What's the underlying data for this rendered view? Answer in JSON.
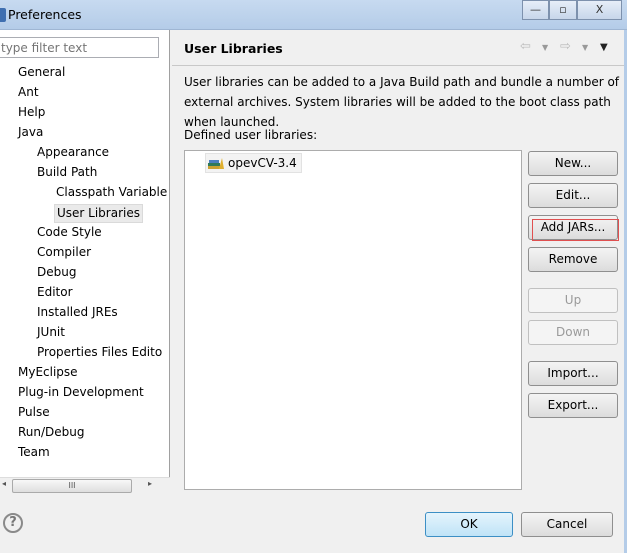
{
  "window": {
    "title": "Preferences",
    "minimize": "—",
    "maximize": "▫",
    "close": "X"
  },
  "sidebar": {
    "filter_placeholder": "type filter text",
    "items": [
      {
        "label": "General",
        "level": 0
      },
      {
        "label": "Ant",
        "level": 0
      },
      {
        "label": "Help",
        "level": 0
      },
      {
        "label": "Java",
        "level": 0
      },
      {
        "label": "Appearance",
        "level": 1
      },
      {
        "label": "Build Path",
        "level": 1
      },
      {
        "label": "Classpath Variable",
        "level": 2
      },
      {
        "label": "User Libraries",
        "level": 2,
        "selected": true
      },
      {
        "label": "Code Style",
        "level": 1
      },
      {
        "label": "Compiler",
        "level": 1
      },
      {
        "label": "Debug",
        "level": 1
      },
      {
        "label": "Editor",
        "level": 1
      },
      {
        "label": "Installed JREs",
        "level": 1
      },
      {
        "label": "JUnit",
        "level": 1
      },
      {
        "label": "Properties Files Edito",
        "level": 1
      },
      {
        "label": "MyEclipse",
        "level": 0
      },
      {
        "label": "Plug-in Development",
        "level": 0
      },
      {
        "label": "Pulse",
        "level": 0
      },
      {
        "label": "Run/Debug",
        "level": 0
      },
      {
        "label": "Team",
        "level": 0
      }
    ],
    "scroll_thumb": "III"
  },
  "page": {
    "title": "User Libraries",
    "description": "User libraries can be added to a Java Build path and bundle a number of external archives. System libraries will be added to the boot class path when launched.",
    "defined_label": "Defined user libraries:",
    "libraries": [
      "opevCV-3.4"
    ],
    "buttons": {
      "new": "New...",
      "edit": "Edit...",
      "add_jars": "Add JARs...",
      "remove": "Remove",
      "up": "Up",
      "down": "Down",
      "import": "Import...",
      "export": "Export..."
    }
  },
  "footer": {
    "help": "?",
    "ok": "OK",
    "cancel": "Cancel"
  },
  "colors": {
    "highlight_box": "#e05050",
    "ok_border": "#3c8fc5"
  }
}
